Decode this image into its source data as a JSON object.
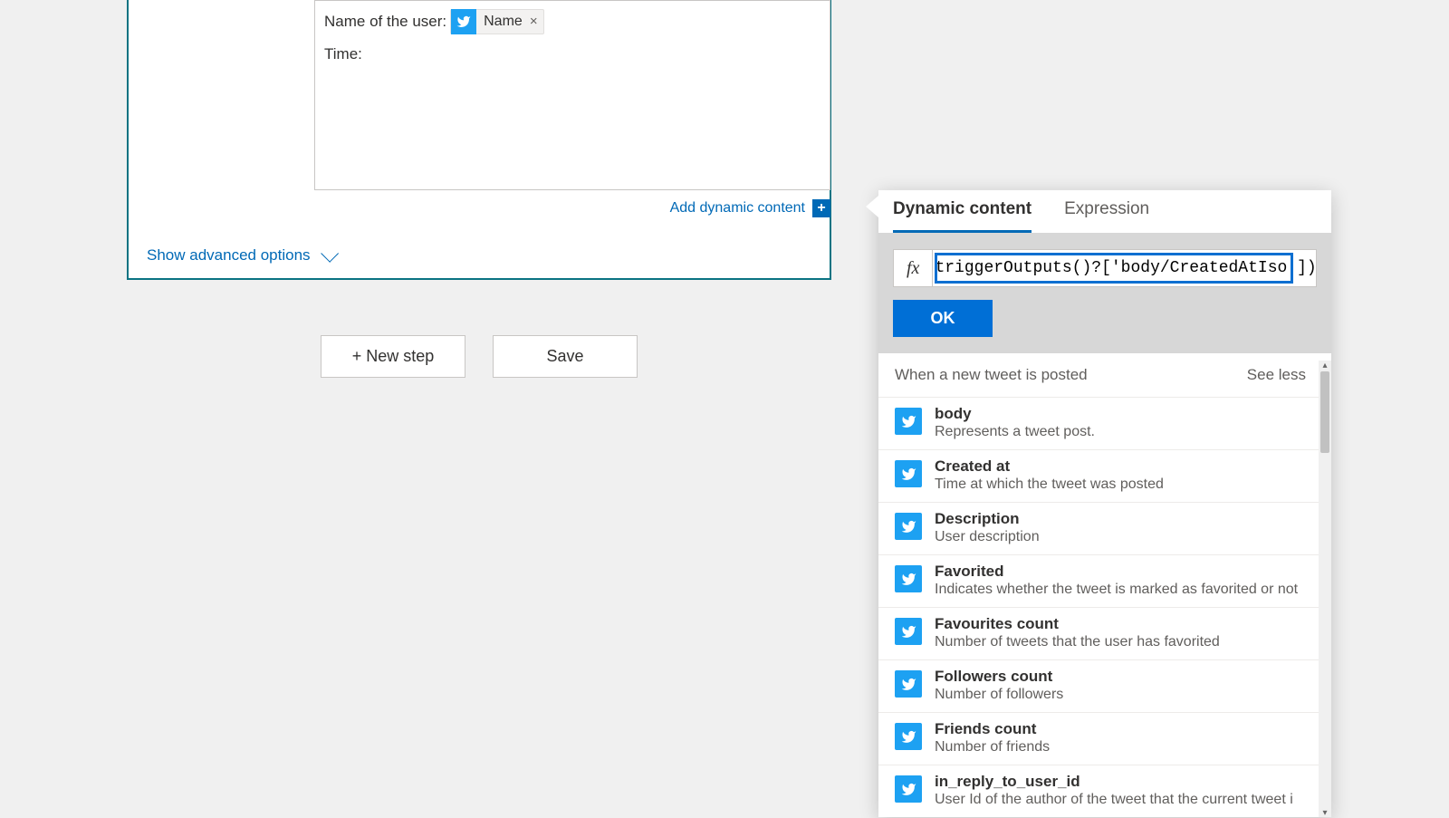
{
  "action": {
    "line1_label": "Name of the user: ",
    "line1_token": "Name",
    "line2_label": "Time:"
  },
  "links": {
    "add_dynamic": "Add dynamic content",
    "show_advanced": "Show advanced options"
  },
  "buttons": {
    "new_step": "+ New step",
    "save": "Save",
    "ok": "OK"
  },
  "panel": {
    "tab_dynamic": "Dynamic content",
    "tab_expression": "Expression",
    "fx": "fx",
    "expression_value": "triggerOutputs()?['body/CreatedAtIso'])",
    "group_title": "When a new tweet is posted",
    "see_less": "See less",
    "items": [
      {
        "title": "body",
        "desc": "Represents a tweet post."
      },
      {
        "title": "Created at",
        "desc": "Time at which the tweet was posted"
      },
      {
        "title": "Description",
        "desc": "User description"
      },
      {
        "title": "Favorited",
        "desc": "Indicates whether the tweet is marked as favorited or not"
      },
      {
        "title": "Favourites count",
        "desc": "Number of tweets that the user has favorited"
      },
      {
        "title": "Followers count",
        "desc": "Number of followers"
      },
      {
        "title": "Friends count",
        "desc": "Number of friends"
      },
      {
        "title": "in_reply_to_user_id",
        "desc": "User Id of the author of the tweet that the current tweet i"
      }
    ]
  }
}
